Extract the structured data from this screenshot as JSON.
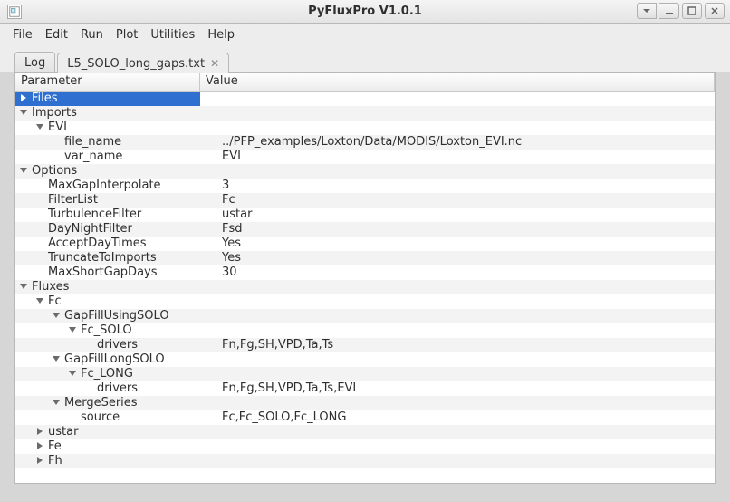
{
  "window": {
    "title": "PyFluxPro V1.0.1"
  },
  "menubar": {
    "file": "File",
    "edit": "Edit",
    "run": "Run",
    "plot": "Plot",
    "utilities": "Utilities",
    "help": "Help"
  },
  "tabs": {
    "log": "Log",
    "active_file": "L5_SOLO_long_gaps.txt"
  },
  "columns": {
    "parameter": "Parameter",
    "value": "Value"
  },
  "tree": {
    "files": "Files",
    "imports": "Imports",
    "evi": "EVI",
    "file_name_key": "file_name",
    "file_name_val": "../PFP_examples/Loxton/Data/MODIS/Loxton_EVI.nc",
    "var_name_key": "var_name",
    "var_name_val": "EVI",
    "options": "Options",
    "maxgap_key": "MaxGapInterpolate",
    "maxgap_val": "3",
    "filterlist_key": "FilterList",
    "filterlist_val": "Fc",
    "turb_key": "TurbulenceFilter",
    "turb_val": "ustar",
    "daynight_key": "DayNightFilter",
    "daynight_val": "Fsd",
    "acceptday_key": "AcceptDayTimes",
    "acceptday_val": "Yes",
    "truncate_key": "TruncateToImports",
    "truncate_val": "Yes",
    "maxshort_key": "MaxShortGapDays",
    "maxshort_val": "30",
    "fluxes": "Fluxes",
    "fc": "Fc",
    "gapfillsolo": "GapFillUsingSOLO",
    "fc_solo": "Fc_SOLO",
    "drivers_key1": "drivers",
    "drivers_val1": "Fn,Fg,SH,VPD,Ta,Ts",
    "gapfilllong": "GapFillLongSOLO",
    "fc_long": "Fc_LONG",
    "drivers_key2": "drivers",
    "drivers_val2": "Fn,Fg,SH,VPD,Ta,Ts,EVI",
    "mergeseries": "MergeSeries",
    "source_key": "source",
    "source_val": "Fc,Fc_SOLO,Fc_LONG",
    "ustar": "ustar",
    "fe": "Fe",
    "fh": "Fh"
  }
}
